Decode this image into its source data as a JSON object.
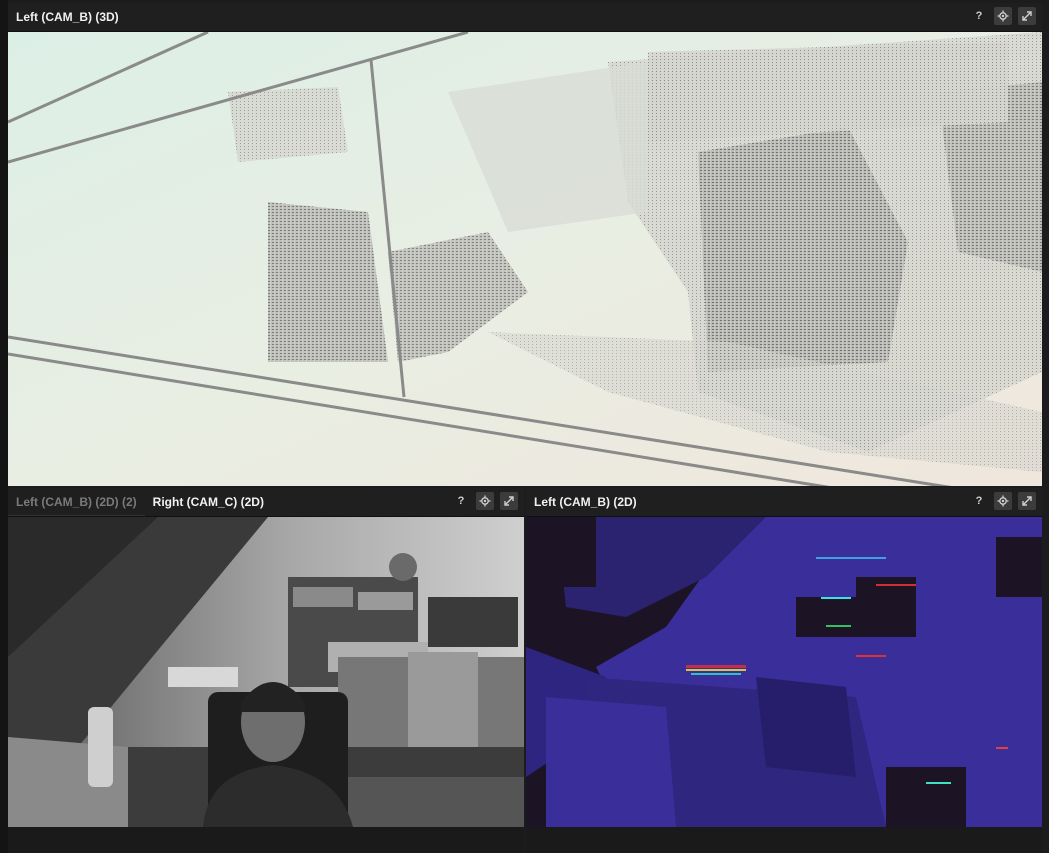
{
  "top_panel": {
    "title": "Left (CAM_B) (3D)",
    "help": "?",
    "icons": [
      "gear-icon",
      "expand-icon"
    ]
  },
  "bottom_left_panel": {
    "tabs": [
      {
        "label": "Left (CAM_B) (2D) (2)",
        "active": false
      },
      {
        "label": "Right (CAM_C) (2D)",
        "active": true
      }
    ],
    "help": "?",
    "icons": [
      "gear-icon",
      "expand-icon"
    ]
  },
  "bottom_right_panel": {
    "title": "Left (CAM_B) (2D)",
    "help": "?",
    "icons": [
      "gear-icon",
      "expand-icon"
    ]
  },
  "colors": {
    "background": "#1c1c1e",
    "header": "#1f1f1f",
    "depth_fill": "#2e2580",
    "depth_shadow": "#1c1424"
  }
}
